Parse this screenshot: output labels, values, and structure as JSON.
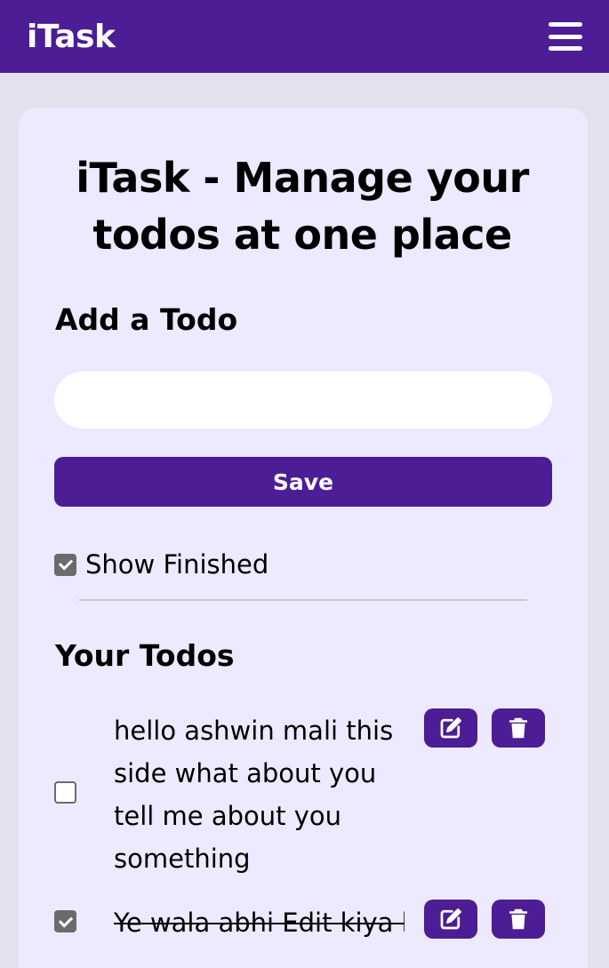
{
  "navbar": {
    "brand": "iTask",
    "menu_icon": "hamburger-menu-icon"
  },
  "main": {
    "title": "iTask - Manage your todos at one place",
    "add_heading": "Add a Todo",
    "todo_input": {
      "value": "",
      "placeholder": ""
    },
    "save_label": "Save",
    "show_finished": {
      "label": "Show Finished",
      "checked": true
    },
    "todos_heading": "Your Todos",
    "todos": [
      {
        "text": "hello ashwin mali this side what about you tell me about you something",
        "completed": false,
        "edit_icon": "edit-icon",
        "delete_icon": "trash-icon"
      },
      {
        "text": "Ye wala abhi Edit kiya h",
        "completed": true,
        "edit_icon": "edit-icon",
        "delete_icon": "trash-icon"
      }
    ]
  },
  "colors": {
    "primary": "#4c1d95",
    "card_background": "#ede9fe",
    "page_background": "#e4e1ee"
  }
}
